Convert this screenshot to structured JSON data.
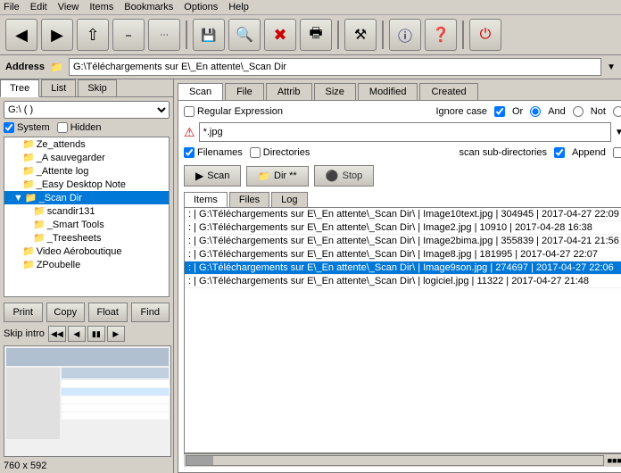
{
  "menubar": {
    "items": [
      "File",
      "Edit",
      "View",
      "Items",
      "Bookmarks",
      "Options",
      "Help"
    ]
  },
  "toolbar": {
    "buttons": [
      "back",
      "forward",
      "up",
      "path",
      "more",
      "save",
      "search",
      "delete",
      "print",
      "tools",
      "info",
      "help",
      "power"
    ]
  },
  "addressbar": {
    "label": "Address",
    "value": "G:\\Téléchargements sur E\\_En attente\\_Scan Dir"
  },
  "left_panel": {
    "tabs": [
      "Tree",
      "List",
      "Skip"
    ],
    "active_tab": "Tree",
    "dropdown_value": "G:\\ ( )",
    "system_checked": true,
    "hidden_checked": false,
    "tree_items": [
      {
        "label": "Ze_attends",
        "depth": 1,
        "expanded": false
      },
      {
        "label": "_A sauvegarder",
        "depth": 1,
        "expanded": false
      },
      {
        "label": "_Attente log",
        "depth": 1,
        "expanded": false
      },
      {
        "label": "_Easy Desktop Note",
        "depth": 1,
        "expanded": false
      },
      {
        "label": "_Scan Dir",
        "depth": 1,
        "expanded": true,
        "selected": true
      },
      {
        "label": "scandir131",
        "depth": 2,
        "expanded": false
      },
      {
        "label": "_Smart Tools",
        "depth": 2,
        "expanded": false
      },
      {
        "label": "_Treesheets",
        "depth": 2,
        "expanded": false
      },
      {
        "label": "Video Aéroboutique",
        "depth": 1,
        "expanded": false
      },
      {
        "label": "ZPoubelle",
        "depth": 1,
        "expanded": false
      }
    ],
    "buttons": [
      "Print",
      "Copy",
      "Float",
      "Find"
    ],
    "skip_label": "Skip intro",
    "size_label": "760 x 592"
  },
  "right_panel": {
    "top_tabs": [
      "Scan",
      "File",
      "Attrib",
      "Size",
      "Modified",
      "Created"
    ],
    "active_tab": "Scan",
    "regular_expression_label": "Regular Expression",
    "regular_expression_checked": false,
    "ignore_case_label": "Ignore case",
    "ignore_case_checked": true,
    "or_label": "Or",
    "and_label": "And",
    "not_label": "Not",
    "pattern_value": "*.jpg",
    "filenames_label": "Filenames",
    "filenames_checked": true,
    "directories_label": "Directories",
    "directories_checked": false,
    "scan_sub_label": "scan sub-directories",
    "scan_sub_checked": true,
    "append_label": "Append",
    "append_checked": false,
    "scan_btn": "Scan",
    "dir_btn": "Dir **",
    "stop_btn": "Stop",
    "result_tabs": [
      "Items",
      "Files",
      "Log"
    ],
    "active_result_tab": "Items",
    "results": [
      ":  | G:\\Téléchargements sur E\\_En attente\\_Scan Dir\\ | Image10text.jpg | 304945 | 2017-04-27 22:09",
      ":  | G:\\Téléchargements sur E\\_En attente\\_Scan Dir\\ | Image2.jpg | 10910 | 2017-04-28 16:38",
      ":  | G:\\Téléchargements sur E\\_En attente\\_Scan Dir\\ | Image2bima.jpg | 355839 | 2017-04-21 21:56",
      ":  | G:\\Téléchargements sur E\\_En attente\\_Scan Dir\\ | Image8.jpg | 181995 | 2017-04-27 22:07",
      ":  | G:\\Téléchargements sur E\\_En attente\\_Scan Dir\\ | Image9son.jpg | 274697 | 2017-04-27 22:06",
      ":  | G:\\Téléchargements sur E\\_En attente\\_Scan Dir\\ | logiciel.jpg | 11322 | 2017-04-27 21:48"
    ],
    "selected_result_index": 4
  }
}
